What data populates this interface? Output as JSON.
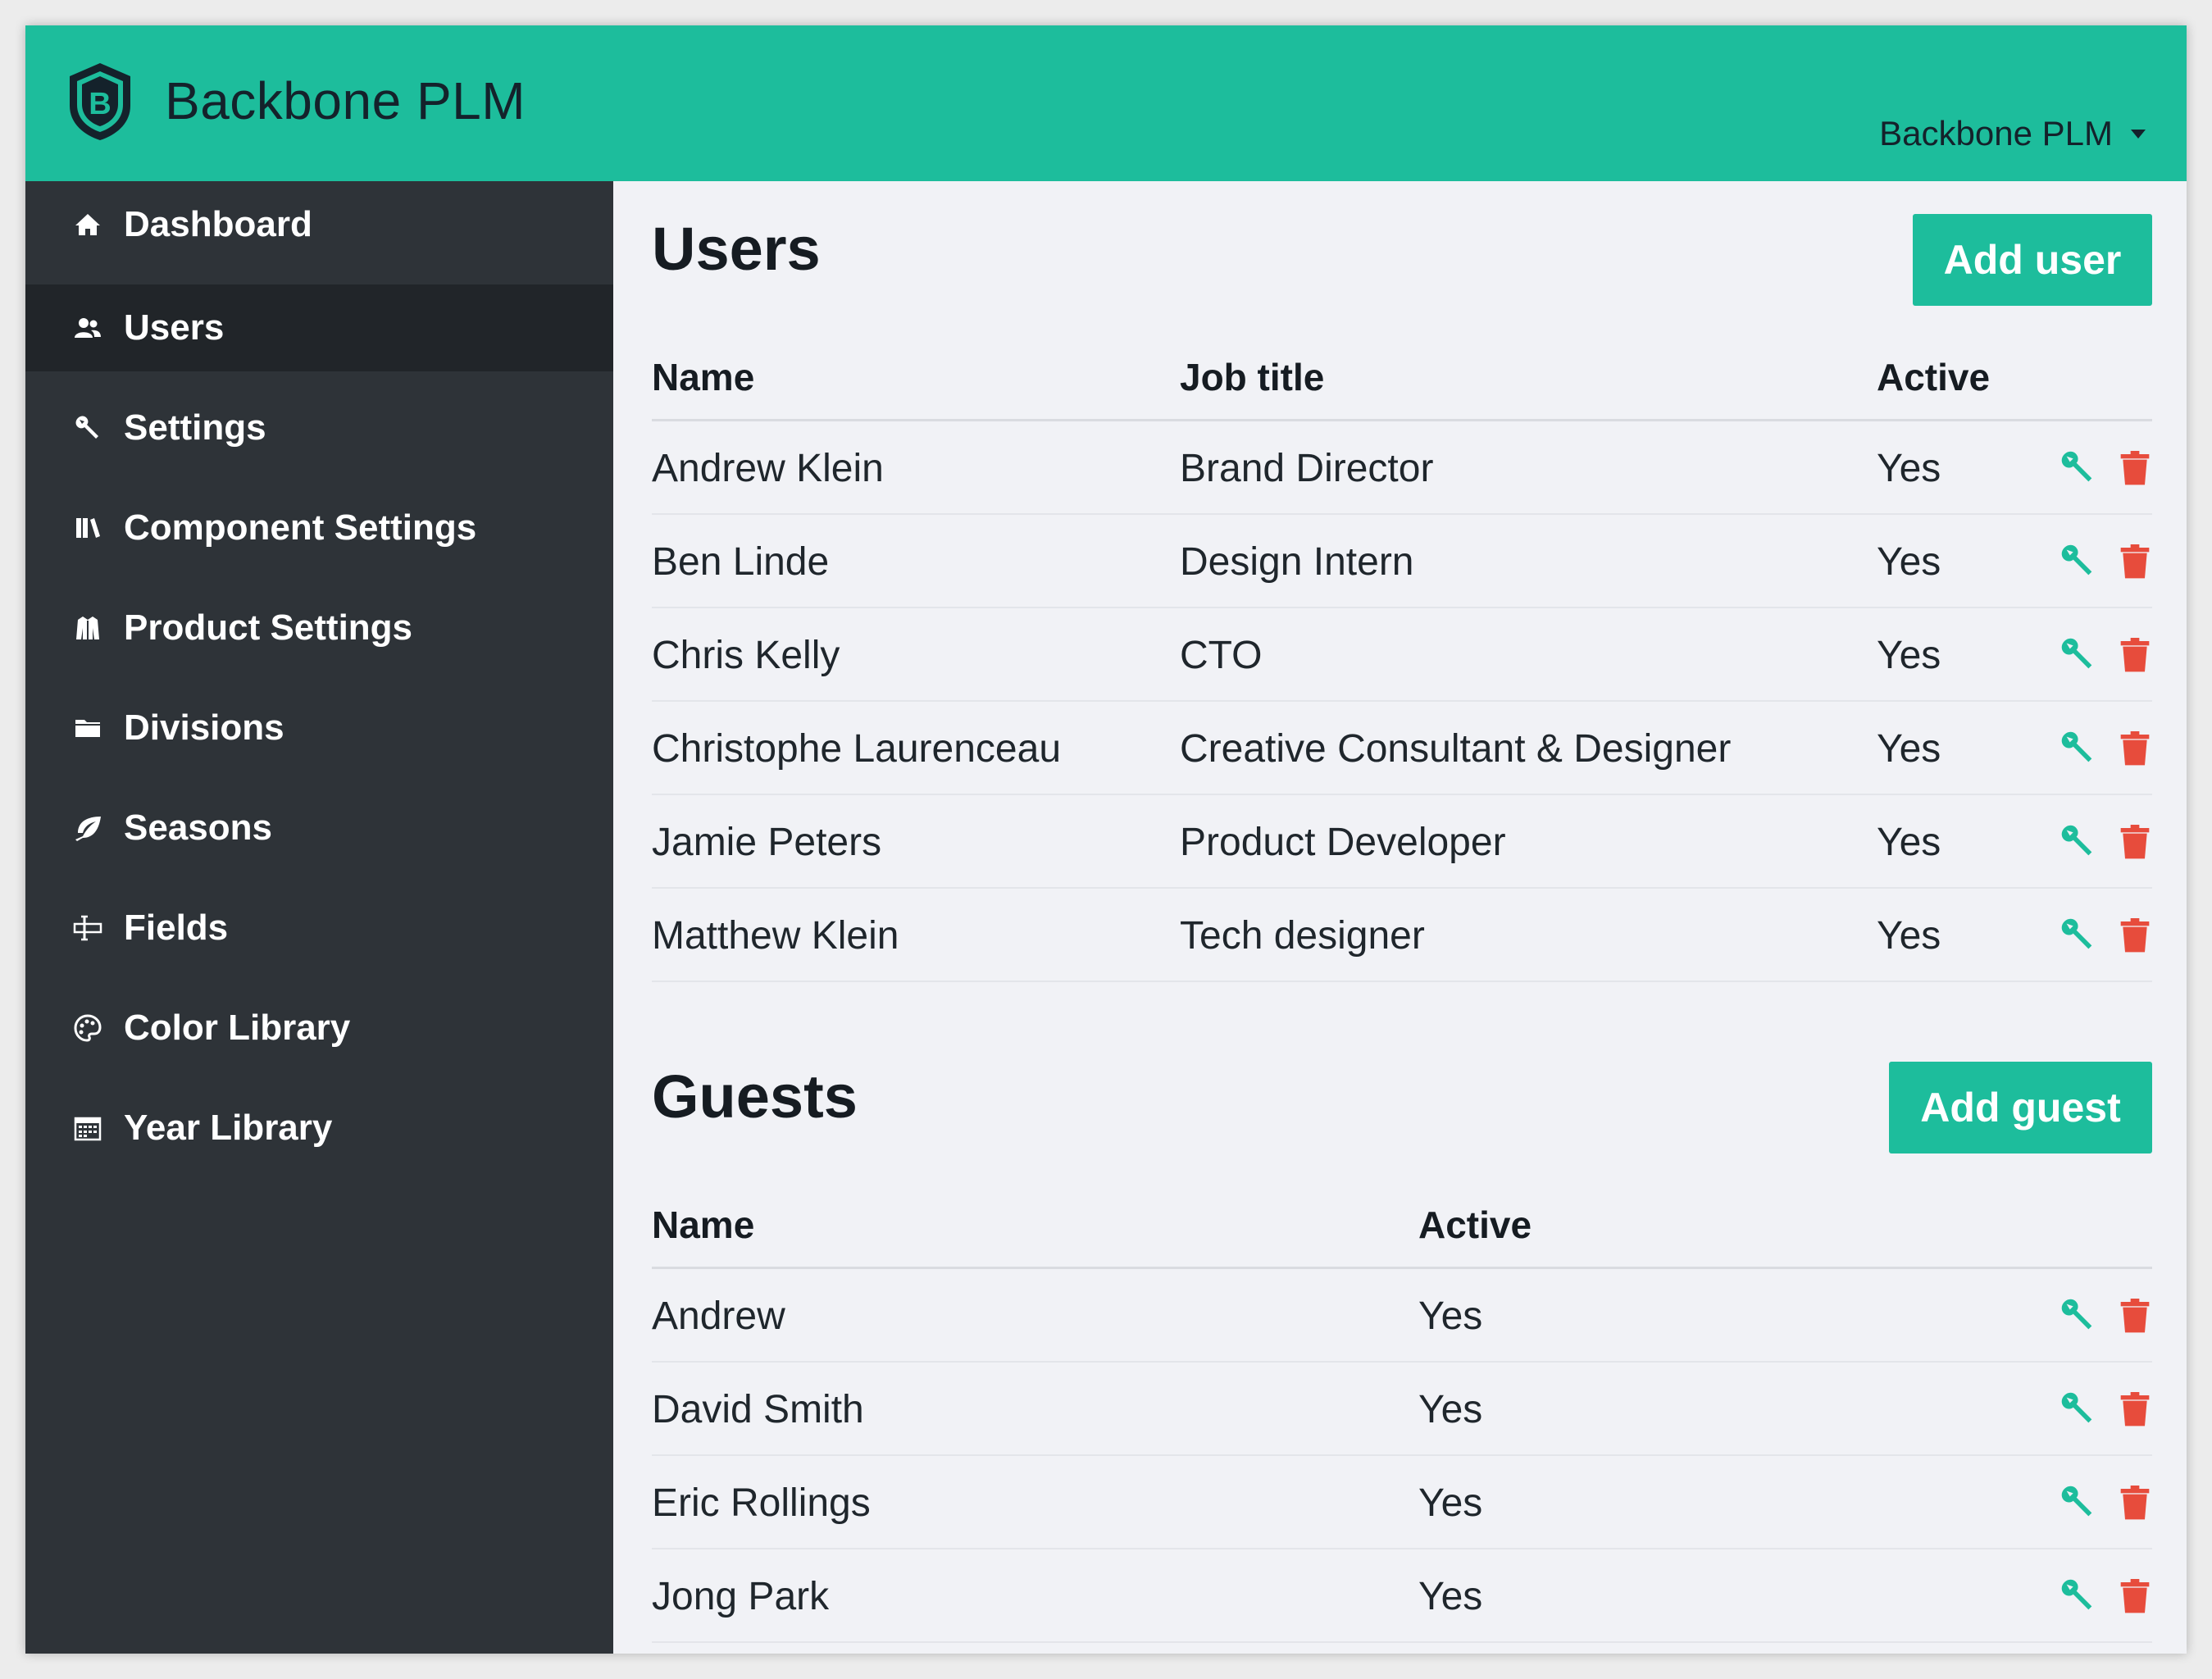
{
  "header": {
    "logo_letter": "B",
    "brand_name": "Backbone PLM",
    "account_label": "Backbone PLM",
    "accent_color": "#1dbd9c"
  },
  "sidebar": {
    "items": [
      {
        "label": "Dashboard",
        "icon": "home-icon",
        "active": false
      },
      {
        "label": "Users",
        "icon": "users-icon",
        "active": true
      },
      {
        "label": "Settings",
        "icon": "wrench-icon",
        "active": false
      },
      {
        "label": "Component Settings",
        "icon": "books-icon",
        "active": false
      },
      {
        "label": "Product Settings",
        "icon": "jacket-icon",
        "active": false
      },
      {
        "label": "Divisions",
        "icon": "folder-icon",
        "active": false
      },
      {
        "label": "Seasons",
        "icon": "leaf-icon",
        "active": false
      },
      {
        "label": "Fields",
        "icon": "field-icon",
        "active": false
      },
      {
        "label": "Color Library",
        "icon": "palette-icon",
        "active": false
      },
      {
        "label": "Year Library",
        "icon": "calendar-icon",
        "active": false
      }
    ]
  },
  "users": {
    "title": "Users",
    "add_label": "Add user",
    "columns": [
      "Name",
      "Job title",
      "Active"
    ],
    "rows": [
      {
        "name": "Andrew Klein",
        "job": "Brand Director",
        "active": "Yes"
      },
      {
        "name": "Ben Linde",
        "job": "Design Intern",
        "active": "Yes"
      },
      {
        "name": "Chris Kelly",
        "job": "CTO",
        "active": "Yes"
      },
      {
        "name": "Christophe Laurenceau",
        "job": "Creative Consultant & Designer",
        "active": "Yes"
      },
      {
        "name": "Jamie Peters",
        "job": "Product Developer",
        "active": "Yes"
      },
      {
        "name": "Matthew Klein",
        "job": "Tech designer",
        "active": "Yes"
      }
    ]
  },
  "guests": {
    "title": "Guests",
    "add_label": "Add guest",
    "columns": [
      "Name",
      "Active"
    ],
    "rows": [
      {
        "name": "Andrew",
        "active": "Yes"
      },
      {
        "name": "David Smith",
        "active": "Yes"
      },
      {
        "name": "Eric Rollings",
        "active": "Yes"
      },
      {
        "name": "Jong Park",
        "active": "Yes"
      }
    ]
  },
  "colors": {
    "edit_icon": "#1dbd9c",
    "delete_icon": "#e74c3c",
    "sidebar_bg": "#2e3338",
    "sidebar_active_bg": "#212529"
  }
}
